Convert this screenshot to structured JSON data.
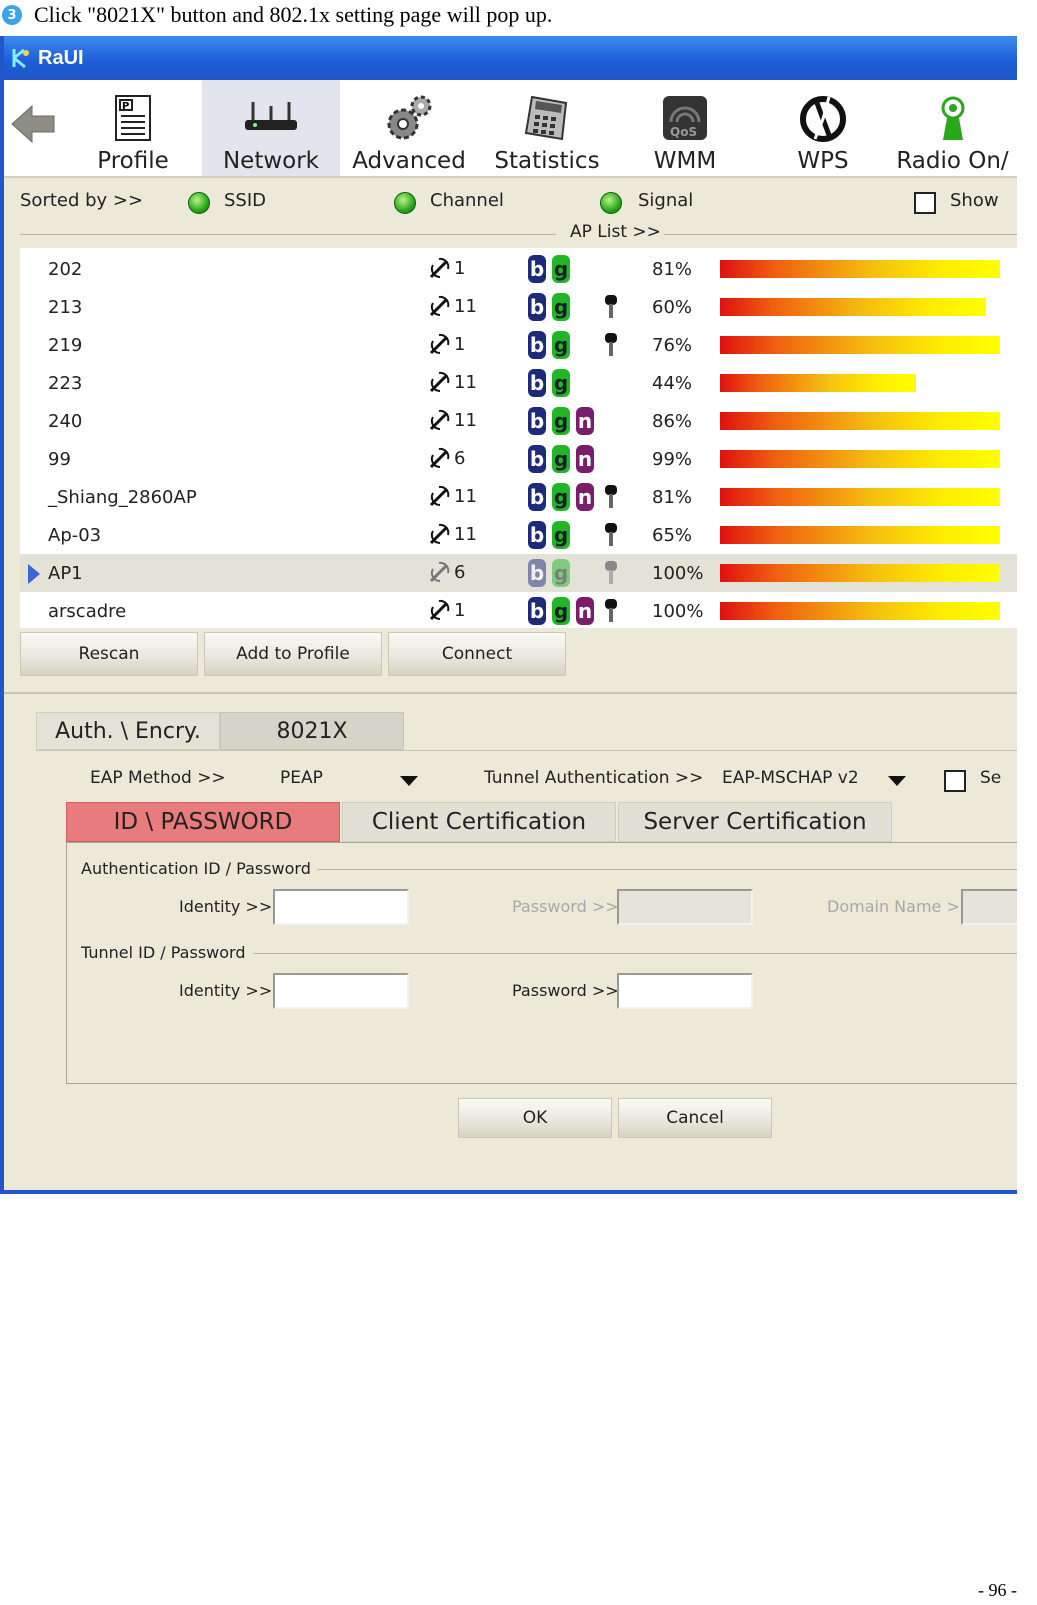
{
  "caption": {
    "step": "3",
    "text": "Click \"8021X\" button and 802.1x setting page will pop up."
  },
  "app": {
    "title": "RaUI"
  },
  "toolbar": {
    "items": [
      {
        "label": "Profile",
        "icon": "profile-icon"
      },
      {
        "label": "Network",
        "icon": "network-icon",
        "active": true
      },
      {
        "label": "Advanced",
        "icon": "gears-icon"
      },
      {
        "label": "Statistics",
        "icon": "calculator-icon"
      },
      {
        "label": "WMM",
        "icon": "qos-icon"
      },
      {
        "label": "WPS",
        "icon": "wps-icon"
      },
      {
        "label": "Radio On/",
        "icon": "radio-icon"
      }
    ]
  },
  "sort": {
    "label": "Sorted by >>",
    "options": [
      "SSID",
      "Channel",
      "Signal"
    ],
    "show_label": "Show",
    "aplist_label": "AP List >>"
  },
  "aplist": {
    "rows": [
      {
        "ssid": "202",
        "channel": "1",
        "modes": [
          "b",
          "g"
        ],
        "secure": false,
        "signal": "81%",
        "level": 1.0
      },
      {
        "ssid": "213",
        "channel": "11",
        "modes": [
          "b",
          "g"
        ],
        "secure": true,
        "signal": "60%",
        "level": 0.95
      },
      {
        "ssid": "219",
        "channel": "1",
        "modes": [
          "b",
          "g"
        ],
        "secure": true,
        "signal": "76%",
        "level": 1.0
      },
      {
        "ssid": "223",
        "channel": "11",
        "modes": [
          "b",
          "g"
        ],
        "secure": false,
        "signal": "44%",
        "level": 0.7
      },
      {
        "ssid": "240",
        "channel": "11",
        "modes": [
          "b",
          "g",
          "n"
        ],
        "secure": false,
        "signal": "86%",
        "level": 1.0
      },
      {
        "ssid": "99",
        "channel": "6",
        "modes": [
          "b",
          "g",
          "n"
        ],
        "secure": false,
        "signal": "99%",
        "level": 1.0
      },
      {
        "ssid": "_Shiang_2860AP",
        "channel": "11",
        "modes": [
          "b",
          "g",
          "n"
        ],
        "secure": true,
        "signal": "81%",
        "level": 1.0
      },
      {
        "ssid": "Ap-03",
        "channel": "11",
        "modes": [
          "b",
          "g"
        ],
        "secure": true,
        "signal": "65%",
        "level": 1.0
      },
      {
        "ssid": "AP1",
        "channel": "6",
        "modes": [
          "b",
          "g"
        ],
        "secure": true,
        "signal": "100%",
        "level": 1.0,
        "selected": true
      },
      {
        "ssid": "arscadre",
        "channel": "1",
        "modes": [
          "b",
          "g",
          "n"
        ],
        "secure": true,
        "signal": "100%",
        "level": 1.0
      }
    ]
  },
  "buttons": {
    "rescan": "Rescan",
    "add_profile": "Add to Profile",
    "connect": "Connect",
    "ok": "OK",
    "cancel": "Cancel"
  },
  "sec_tabs": {
    "auth": "Auth. \\ Encry.",
    "x8021": "8021X"
  },
  "eap": {
    "method_label": "EAP Method >>",
    "method_value": "PEAP",
    "tunnel_label": "Tunnel Authentication >>",
    "tunnel_value": "EAP-MSCHAP v2",
    "extra_label": "Se"
  },
  "cert_tabs": {
    "id_pw": "ID \\ PASSWORD",
    "client": "Client Certification",
    "server": "Server Certification"
  },
  "auth_group": {
    "title": "Authentication ID / Password",
    "identity": "Identity >>",
    "password": "Password >>",
    "domain": "Domain Name >>"
  },
  "tunnel_group": {
    "title": "Tunnel ID / Password",
    "identity": "Identity >>",
    "password": "Password >>"
  },
  "page_number": "- 96 -"
}
